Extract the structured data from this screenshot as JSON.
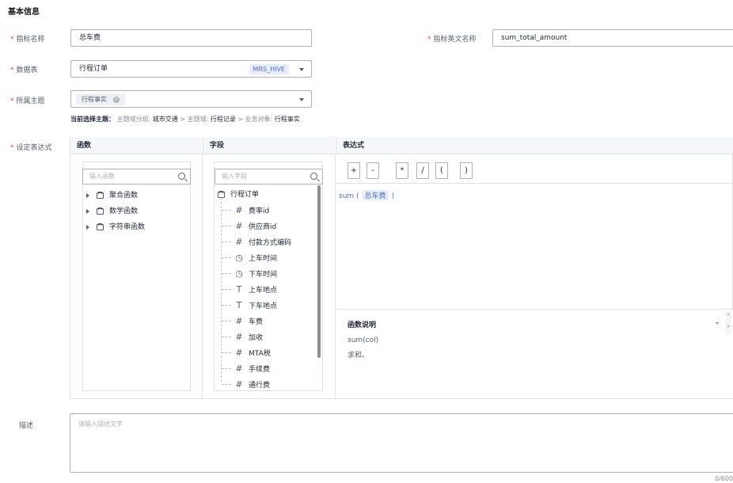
{
  "section_title": "基本信息",
  "required_mark": "*",
  "metric_name": {
    "label": "指标名称",
    "value": "总车费"
  },
  "metric_en_name": {
    "label": "指标英文名称",
    "value": "sum_total_amount"
  },
  "data_table": {
    "label": "数据表",
    "value": "行程订单",
    "source_tag": "MRS_HIVE"
  },
  "topic": {
    "label": "所属主题",
    "chip": "行程事实",
    "chip_close": "×"
  },
  "topic_hint": {
    "prefix": "当前选择主题：",
    "group_label": "主题域分组:",
    "group_value": "城市交通",
    "sep": ">",
    "domain_label": "主题域:",
    "domain_value": "行程记录",
    "object_label": "业务对象:",
    "object_value": "行程事实"
  },
  "expression": {
    "label": "设定表达式",
    "functions_header": "函数",
    "fields_header": "字段",
    "expression_header": "表达式",
    "function_search_placeholder": "输入函数",
    "field_search_placeholder": "输入字段",
    "function_groups": [
      "聚合函数",
      "数学函数",
      "字符串函数"
    ],
    "field_root": "行程订单",
    "fields": [
      {
        "icon": "#",
        "icon_name": "number-icon",
        "name": "费率id"
      },
      {
        "icon": "#",
        "icon_name": "number-icon",
        "name": "供应商id"
      },
      {
        "icon": "#",
        "icon_name": "number-icon",
        "name": "付款方式编码"
      },
      {
        "icon": "◷",
        "icon_name": "clock-icon",
        "name": "上车时间"
      },
      {
        "icon": "◷",
        "icon_name": "clock-icon",
        "name": "下车时间"
      },
      {
        "icon": "T",
        "icon_name": "text-icon",
        "name": "上车地点"
      },
      {
        "icon": "T",
        "icon_name": "text-icon",
        "name": "下车地点"
      },
      {
        "icon": "#",
        "icon_name": "number-icon",
        "name": "车费"
      },
      {
        "icon": "#",
        "icon_name": "number-icon",
        "name": "加收"
      },
      {
        "icon": "#",
        "icon_name": "number-icon",
        "name": "MTA税"
      },
      {
        "icon": "#",
        "icon_name": "number-icon",
        "name": "手续费"
      },
      {
        "icon": "#",
        "icon_name": "number-icon",
        "name": "通行费"
      }
    ],
    "operators": [
      "+",
      "-",
      "*",
      "/",
      "(",
      ")"
    ],
    "expr_func": "sum (",
    "expr_field": "总车费",
    "expr_close": ")",
    "fn_desc_title": "函数说明",
    "fn_desc_sig": "sum(col)",
    "fn_desc_text": "求和。"
  },
  "description": {
    "label": "描述",
    "placeholder": "请输入描述文字",
    "counter": "0/600"
  },
  "colors": {
    "required": "#e54545",
    "accent": "#526ecc",
    "border": "#adb0b8"
  }
}
